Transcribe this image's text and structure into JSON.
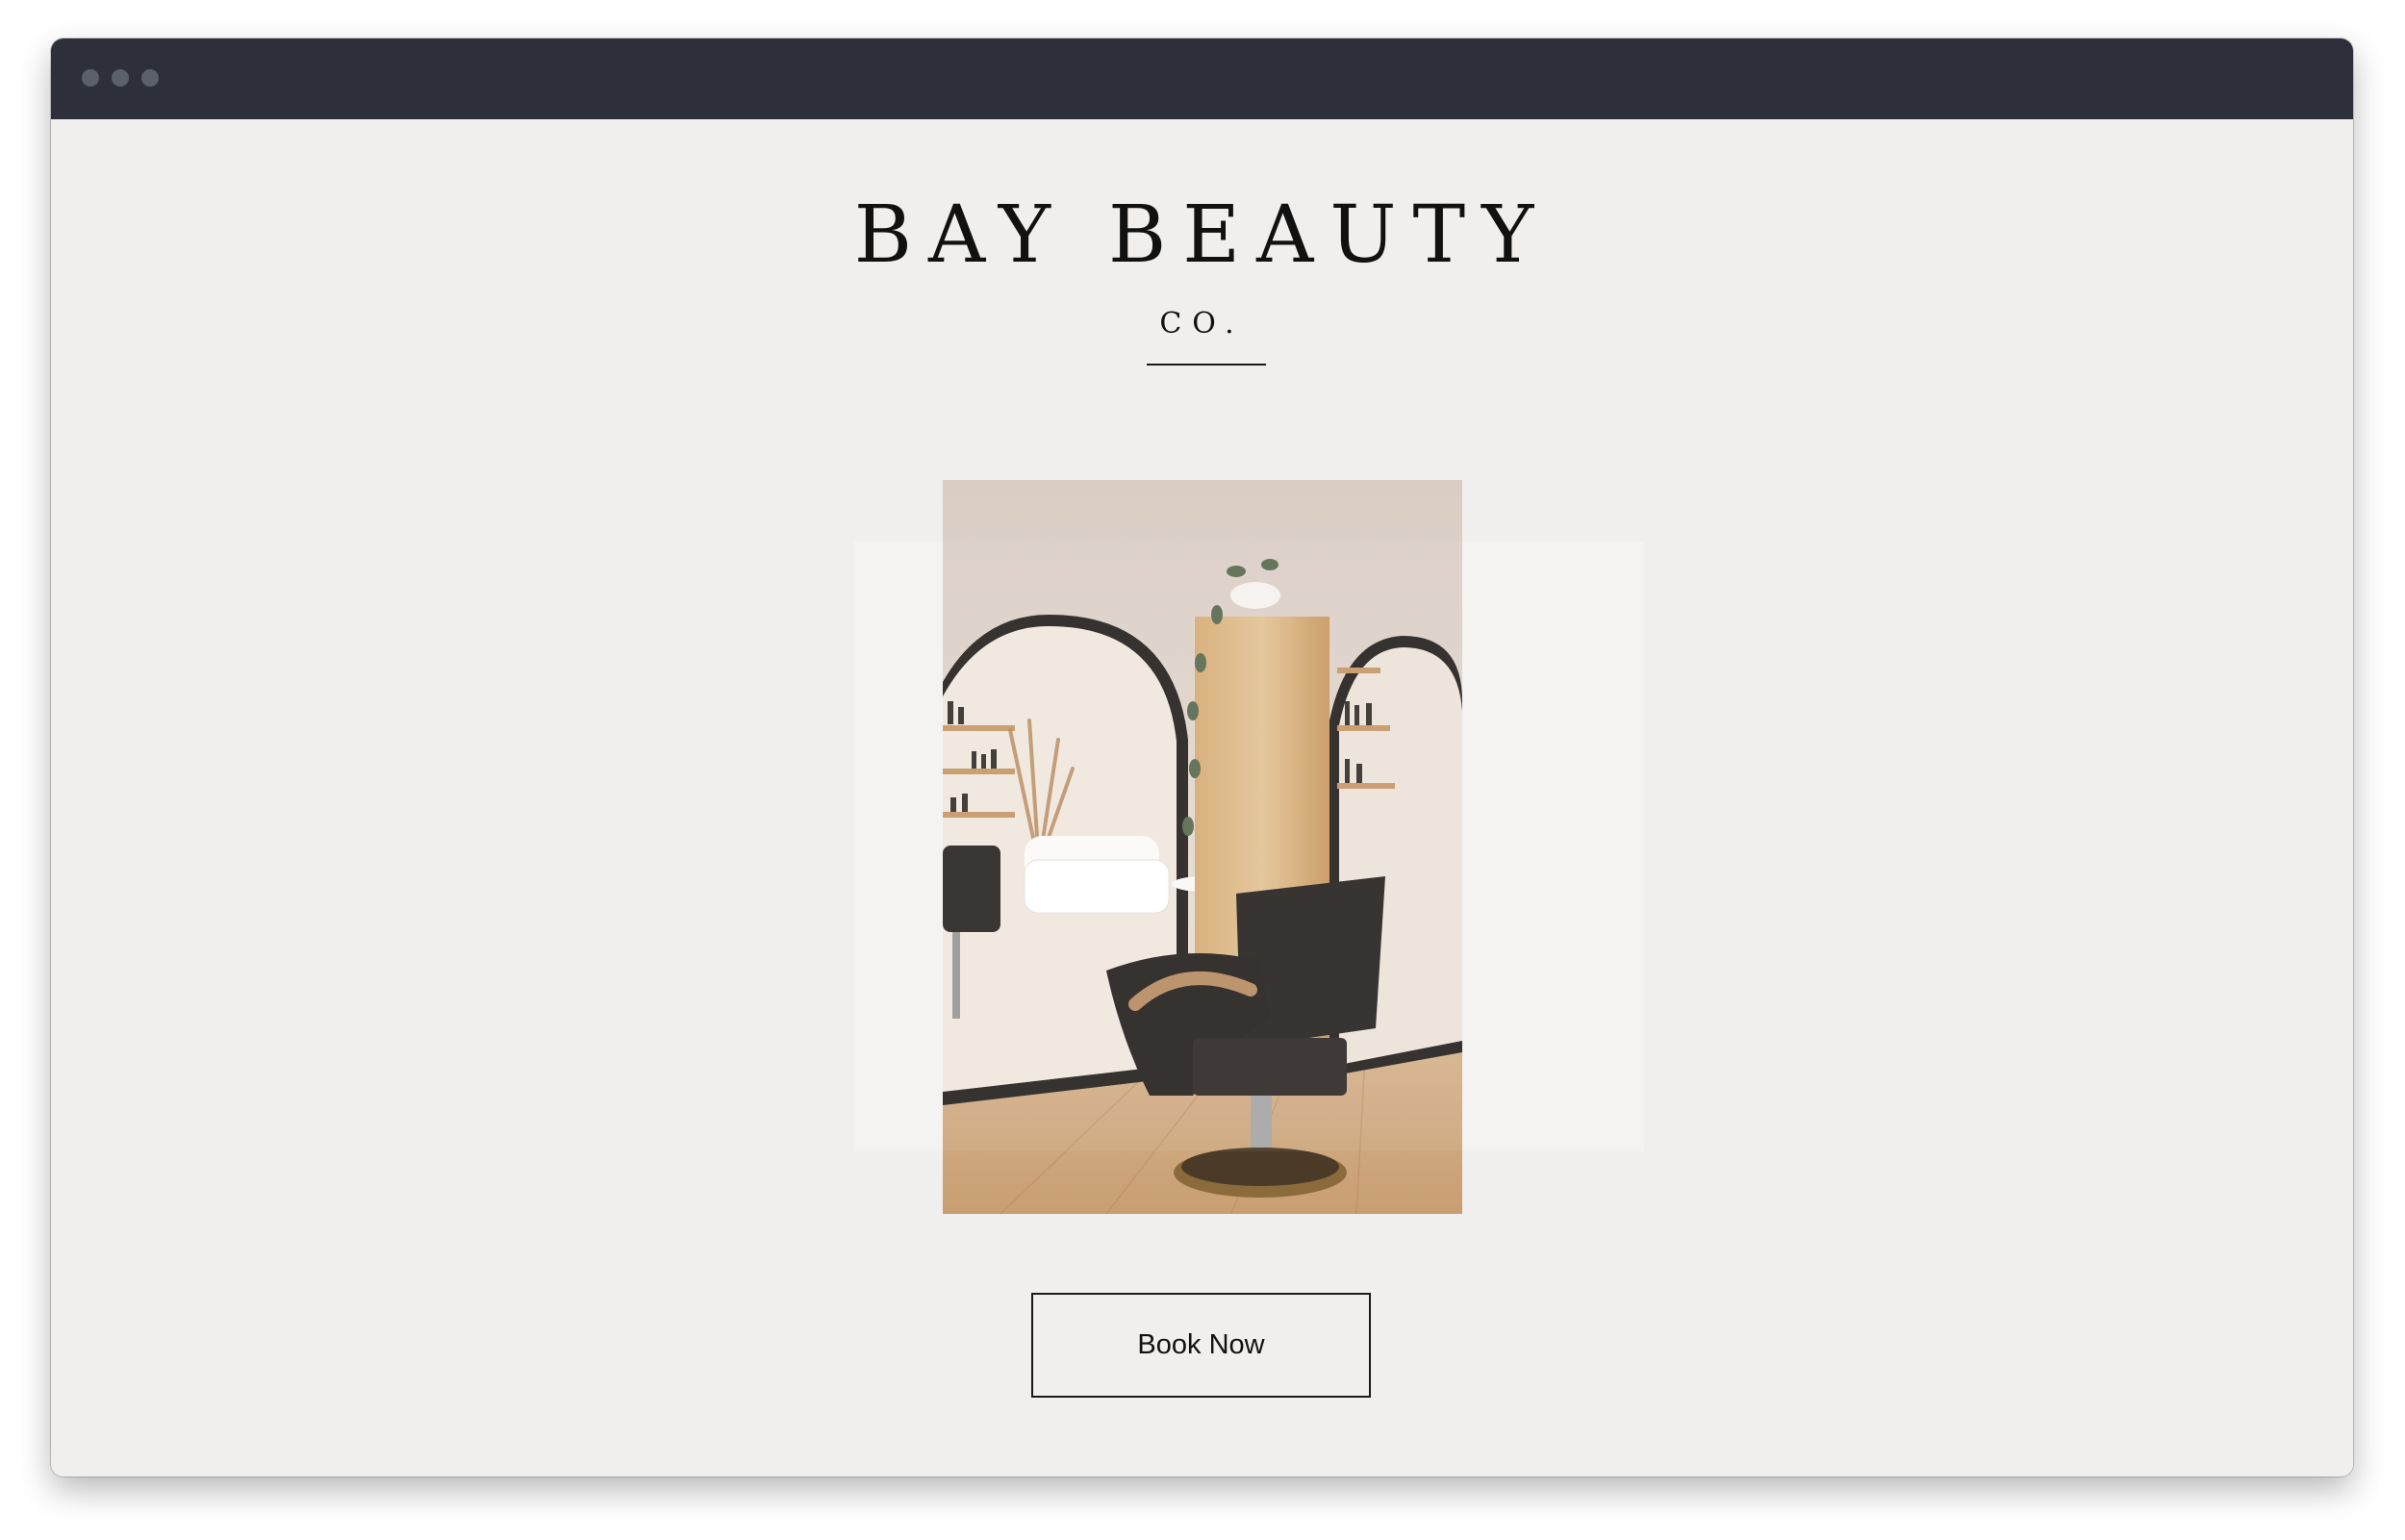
{
  "window": {
    "controls": [
      "window-dot-icon",
      "window-dot-icon",
      "window-dot-icon"
    ]
  },
  "brand": {
    "name": "BAY BEAUTY",
    "suffix": "CO."
  },
  "hero_image": {
    "alt": "salon interior with styling chair, arched mirrors and wooden column"
  },
  "cta": {
    "label": "Book Now"
  },
  "colors": {
    "titlebar": "#2d303a",
    "page_background": "#f0efed",
    "text": "#111111"
  }
}
